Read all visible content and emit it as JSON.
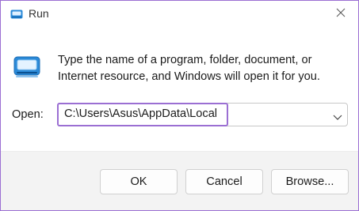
{
  "window": {
    "title": "Run",
    "accent_color": "#9b6fd3"
  },
  "icons": {
    "title_icon": "run-app-icon",
    "app_icon": "run-app-icon",
    "close_icon": "close-icon",
    "dropdown_icon": "chevron-down-icon"
  },
  "content": {
    "description": "Type the name of a program, folder, document, or Internet resource, and Windows will open it for you.",
    "open_label": "Open:",
    "open_value": "C:\\Users\\Asus\\AppData\\Local"
  },
  "buttons": {
    "ok": "OK",
    "cancel": "Cancel",
    "browse": "Browse..."
  }
}
